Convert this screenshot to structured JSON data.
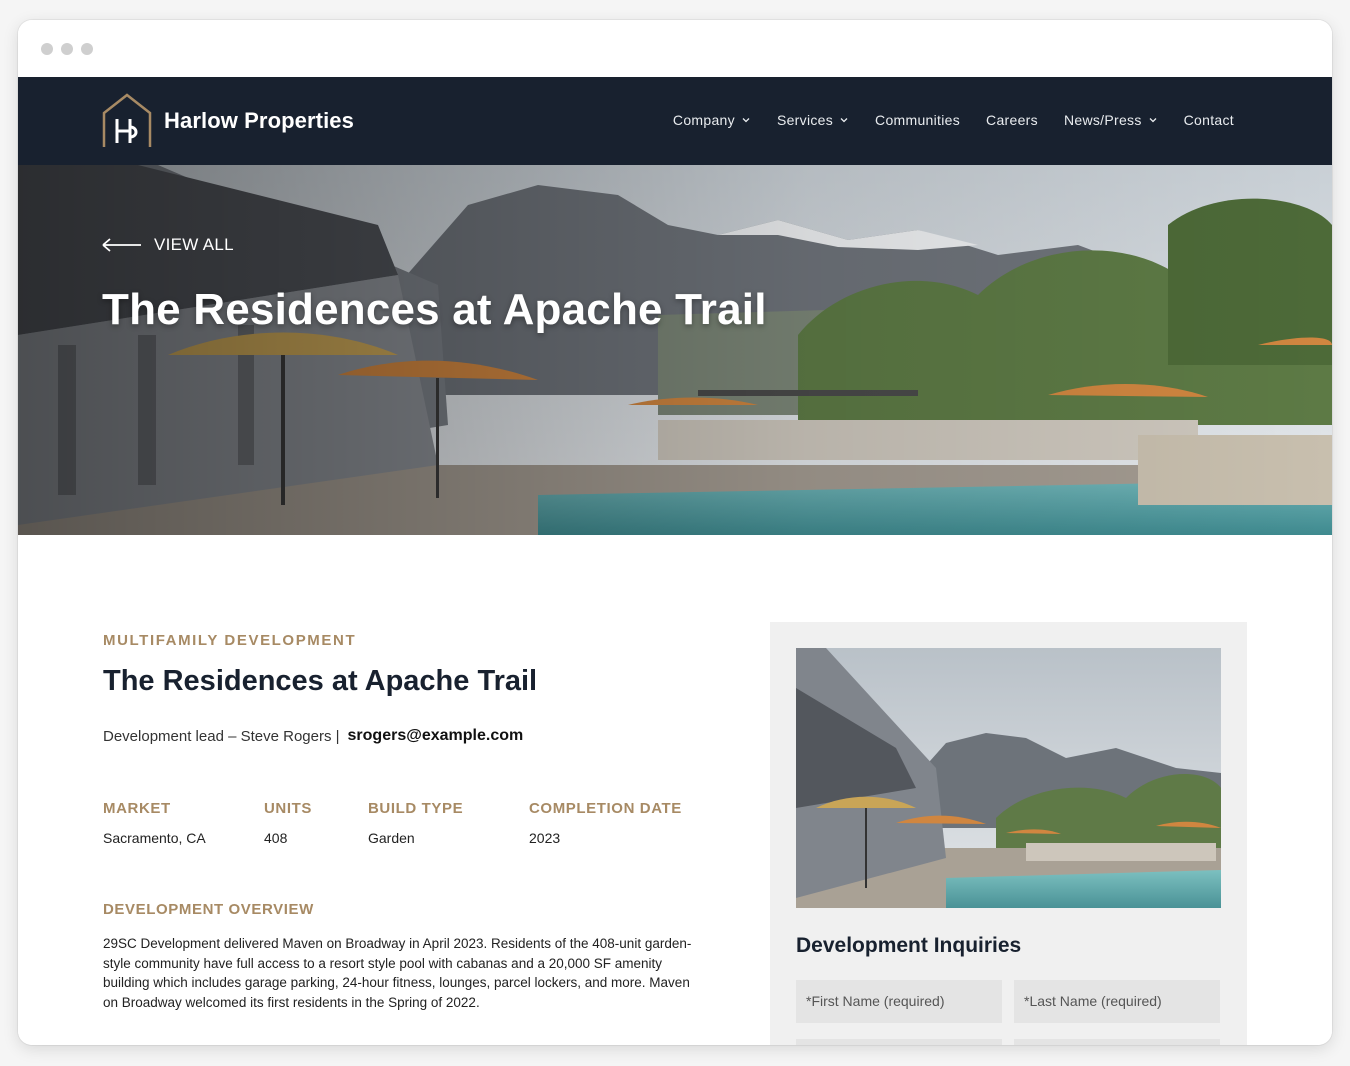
{
  "brand": {
    "name": "Harlow Properties",
    "accent": "#a78a64",
    "navy": "#18212f"
  },
  "nav": {
    "items": [
      {
        "label": "Company",
        "dropdown": true
      },
      {
        "label": "Services",
        "dropdown": true
      },
      {
        "label": "Communities",
        "dropdown": false
      },
      {
        "label": "Careers",
        "dropdown": false
      },
      {
        "label": "News/Press",
        "dropdown": true
      },
      {
        "label": "Contact",
        "dropdown": false
      }
    ]
  },
  "hero": {
    "back_label": "VIEW ALL",
    "back_icon": "arrow-left-icon",
    "title": "The Residences at Apache Trail"
  },
  "details": {
    "eyebrow": "MULTIFAMILY DEVELOPMENT",
    "title": "The Residences at Apache Trail",
    "lead_text": "Development lead – Steve Rogers |",
    "lead_email": "srogers@example.com",
    "specs": [
      {
        "label": "MARKET",
        "value": "Sacramento, CA"
      },
      {
        "label": "UNITS",
        "value": "408"
      },
      {
        "label": "BUILD TYPE",
        "value": "Garden"
      },
      {
        "label": "COMPLETION DATE",
        "value": "2023"
      }
    ],
    "overview_label": "DEVELOPMENT OVERVIEW",
    "overview_text": "29SC Development delivered Maven on Broadway in April 2023. Residents of the 408-unit garden-style community have full access to a resort style pool with cabanas and a 20,000 SF amenity building which includes garage parking, 24-hour fitness, lounges, parcel lockers, and more. Maven on Broadway welcomed its first residents in the Spring of 2022."
  },
  "inquiry": {
    "title": "Development Inquiries",
    "first_name_placeholder": "*First Name (required)",
    "last_name_placeholder": "*Last Name (required)"
  }
}
